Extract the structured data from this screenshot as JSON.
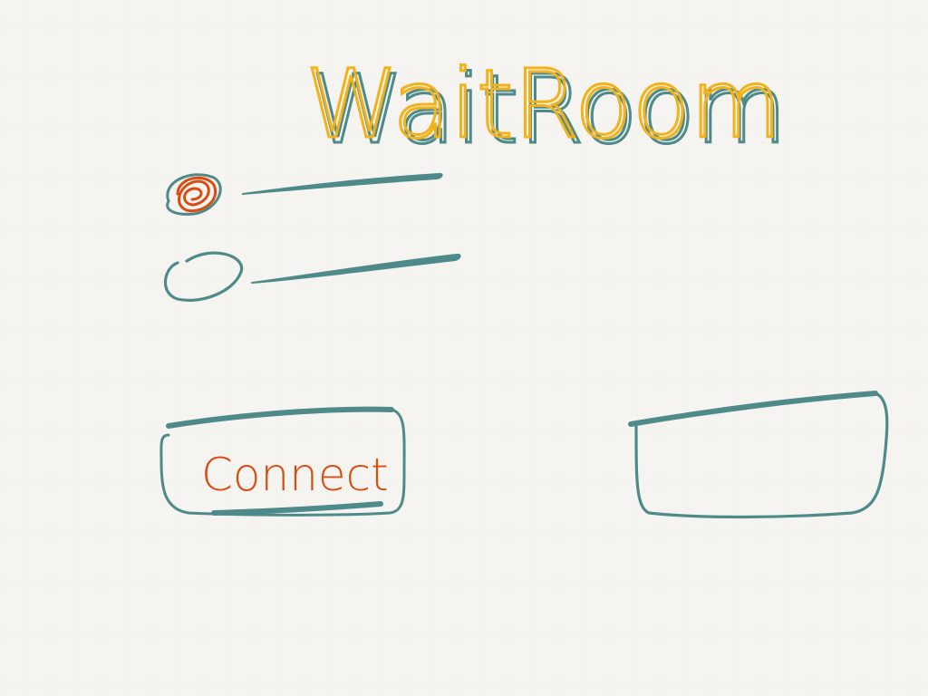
{
  "app": {
    "title": "WaitRoom"
  },
  "colors": {
    "title_fill": "#f2b21b",
    "title_shadow": "#4e8a8a",
    "stroke_teal": "#4e8a8a",
    "accent_orange": "#d94c12",
    "background": "#f5f4f1"
  },
  "options": [
    {
      "selected": true
    },
    {
      "selected": false
    }
  ],
  "buttons": {
    "connect_label": "Connect"
  }
}
